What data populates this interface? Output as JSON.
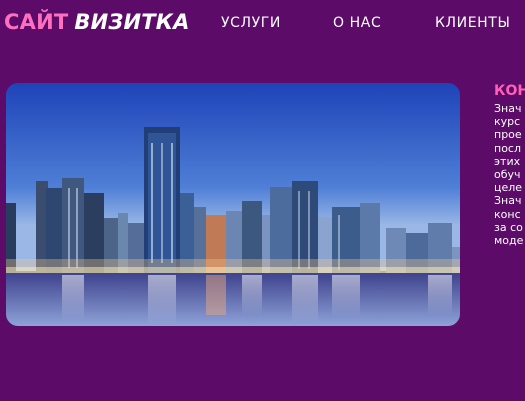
{
  "header": {
    "logo_part1": "САЙТ",
    "logo_part2": "ВИЗИТКА",
    "nav": [
      "УСЛУГИ",
      "О НАС",
      "КЛИЕНТЫ"
    ]
  },
  "hero": {
    "image": "city skyline at night reflected in water"
  },
  "sidebar": {
    "title": "КОН",
    "text": "Знач\nкурс\nпрое\nпосл\nэтих\nобуч\nцеле\nЗнач\nконс\nза со\nмоде"
  },
  "colors": {
    "background": "#5c0b68",
    "accent": "#ff6fc0"
  }
}
